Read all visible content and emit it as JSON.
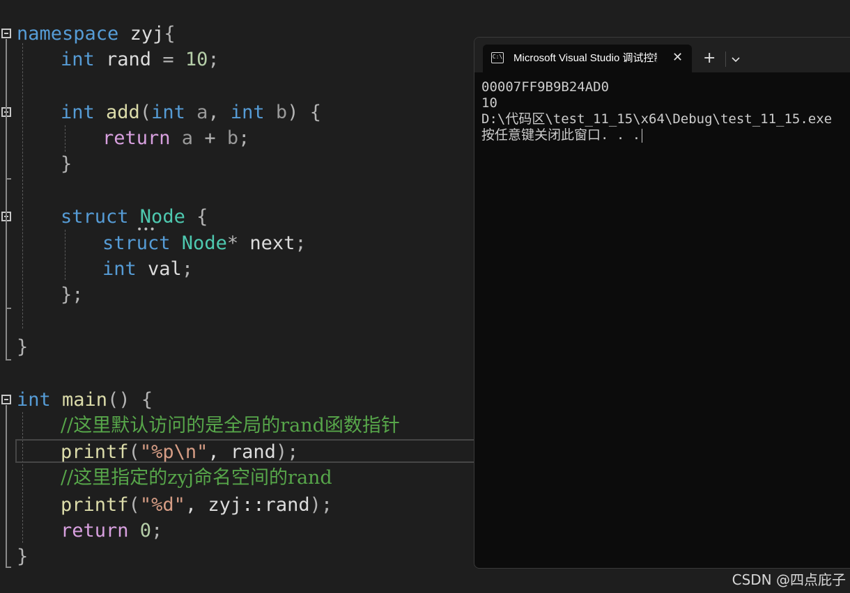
{
  "code": {
    "l1": {
      "kw": "namespace",
      "name": " zyj",
      "brace": "{"
    },
    "l2": {
      "type": "int",
      "name": " rand ",
      "op": "= ",
      "num": "10",
      "end": ";"
    },
    "l4": {
      "type": "int",
      "fn": " add",
      "open": "(",
      "t1": "int",
      "p1": " a",
      "comma": ", ",
      "t2": "int",
      "p2": " b",
      "close": ") {"
    },
    "l5": {
      "kw": "return",
      "a": " a",
      "op": " + ",
      "b": "b",
      "end": ";"
    },
    "l6": {
      "brace": "}"
    },
    "l8": {
      "kw": "struct",
      "name": " Node",
      "brace": " {"
    },
    "l9": {
      "kw": "struct",
      "type": " Node",
      "star": "*",
      "name": " next",
      "end": ";"
    },
    "l10": {
      "type": "int",
      "name": " val",
      "end": ";"
    },
    "l11": {
      "brace": "};"
    },
    "l13": {
      "brace": "}"
    },
    "l15": {
      "type": "int",
      "fn": " main",
      "paren": "() {"
    },
    "l16": {
      "comment": "//这里默认访问的是全局的rand函数指针"
    },
    "l17": {
      "fn": "printf",
      "open": "(",
      "str": "\"%p\\n\"",
      "rest": ", rand",
      "close": ");"
    },
    "l18": {
      "comment": "//这里指定的zyj命名空间的rand"
    },
    "l19": {
      "fn": "printf",
      "open": "(",
      "str": "\"%d\"",
      "rest": ", zyj::rand",
      "close": ");"
    },
    "l20": {
      "kw": "return",
      "num": " 0",
      "end": ";"
    },
    "l21": {
      "brace": "}"
    }
  },
  "console": {
    "tab_icon": "C:\\",
    "tab_title": "Microsoft Visual Studio 调试控制台",
    "close_icon": "✕",
    "new_tab": "+",
    "output": [
      "00007FF9B9B24AD0",
      "10",
      "D:\\代码区\\test_11_15\\x64\\Debug\\test_11_15.exe",
      "按任意键关闭此窗口. . ."
    ]
  },
  "watermark": "CSDN @四点庇子",
  "icons": [
    "collapse-icon",
    "terminal-icon",
    "close-icon",
    "plus-icon",
    "chevron-down-icon"
  ]
}
